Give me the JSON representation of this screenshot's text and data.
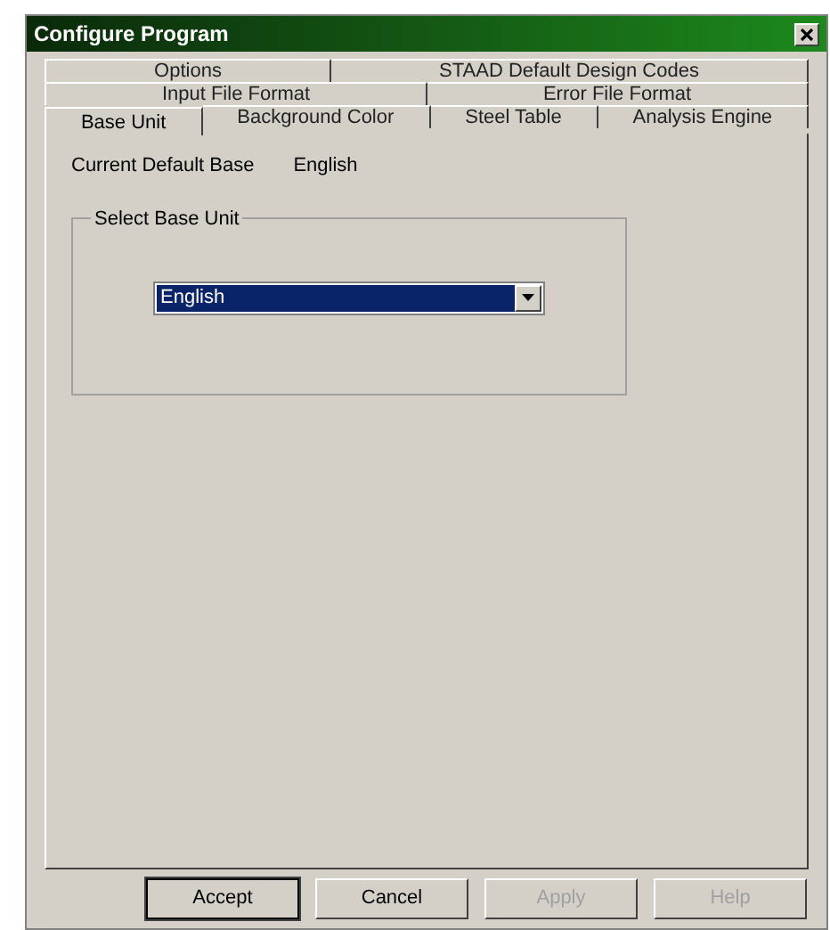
{
  "window": {
    "title": "Configure Program"
  },
  "tab_rows": [
    [
      {
        "label": "Options",
        "selected": false
      },
      {
        "label": "STAAD Default Design Codes",
        "selected": false
      }
    ],
    [
      {
        "label": "Input File Format",
        "selected": false
      },
      {
        "label": "Error File Format",
        "selected": false
      }
    ],
    [
      {
        "label": "Base Unit",
        "selected": true
      },
      {
        "label": "Background Color",
        "selected": false
      },
      {
        "label": "Steel Table",
        "selected": false
      },
      {
        "label": "Analysis Engine",
        "selected": false
      }
    ]
  ],
  "current_default_base": {
    "label": "Current Default Base",
    "value": "English"
  },
  "base_unit_group": {
    "title": "Select Base Unit",
    "dropdown": {
      "value": "English"
    }
  },
  "buttons": [
    {
      "label": "Accept",
      "default": true,
      "disabled": false
    },
    {
      "label": "Cancel",
      "default": false,
      "disabled": false
    },
    {
      "label": "Apply",
      "default": false,
      "disabled": true
    },
    {
      "label": "Help",
      "default": false,
      "disabled": true
    }
  ]
}
